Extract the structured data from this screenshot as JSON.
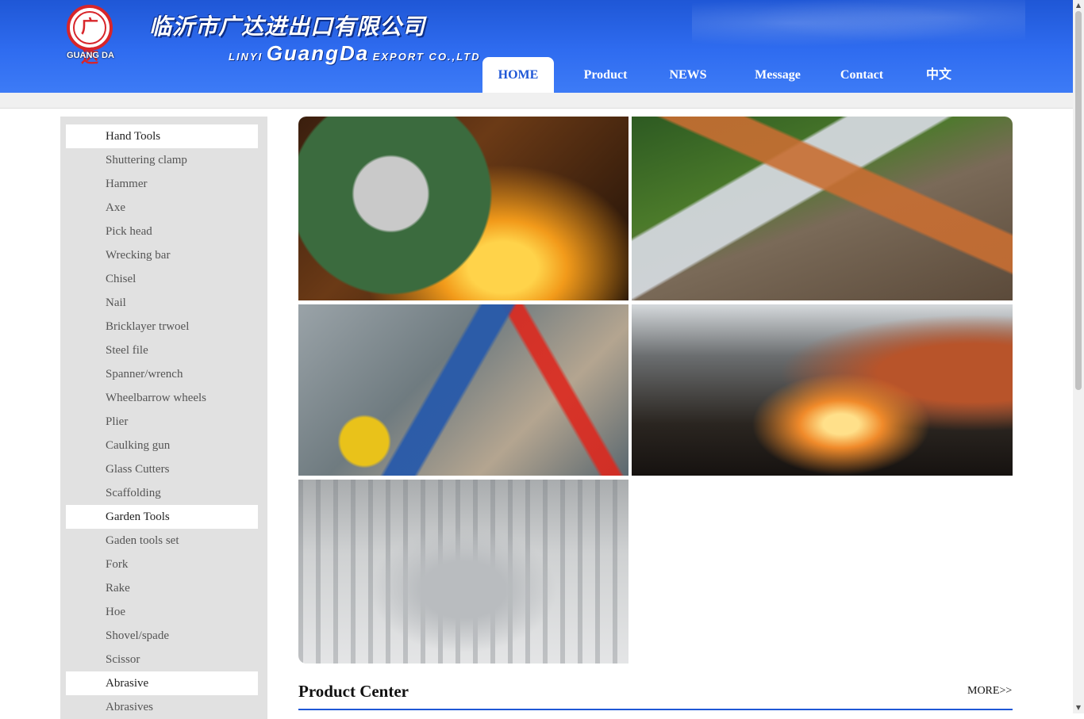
{
  "brand": {
    "logo_glyph": "广达",
    "logo_text": "GUANG DA",
    "name_cn": "临沂市广达进出口有限公司",
    "name_en_prefix": "LINYI",
    "name_en_main": "GuangDa",
    "name_en_suffix": "EXPORT CO.,LTD",
    "primary_color": "#1f57d6",
    "logo_color": "#d8252a"
  },
  "nav": {
    "items": [
      {
        "label": "HOME",
        "active": true
      },
      {
        "label": "Product",
        "active": false
      },
      {
        "label": "NEWS",
        "active": false
      },
      {
        "label": "Message",
        "active": false
      },
      {
        "label": "Contact",
        "active": false
      },
      {
        "label": "中文",
        "active": false
      }
    ]
  },
  "sidebar": {
    "items": [
      {
        "label": "Hand Tools",
        "type": "category"
      },
      {
        "label": "Shuttering clamp",
        "type": "item"
      },
      {
        "label": "Hammer",
        "type": "item"
      },
      {
        "label": "Axe",
        "type": "item"
      },
      {
        "label": "Pick head",
        "type": "item"
      },
      {
        "label": "Wrecking bar",
        "type": "item"
      },
      {
        "label": "Chisel",
        "type": "item"
      },
      {
        "label": "Nail",
        "type": "item"
      },
      {
        "label": "Bricklayer trwoel",
        "type": "item"
      },
      {
        "label": "Steel file",
        "type": "item"
      },
      {
        "label": "Spanner/wrench",
        "type": "item"
      },
      {
        "label": "Wheelbarrow wheels",
        "type": "item"
      },
      {
        "label": "Plier",
        "type": "item"
      },
      {
        "label": "Caulking gun",
        "type": "item"
      },
      {
        "label": "Glass Cutters",
        "type": "item"
      },
      {
        "label": "Scaffolding",
        "type": "item"
      },
      {
        "label": "Garden Tools",
        "type": "category"
      },
      {
        "label": "Gaden tools set",
        "type": "item"
      },
      {
        "label": "Fork",
        "type": "item"
      },
      {
        "label": "Rake",
        "type": "item"
      },
      {
        "label": "Hoe",
        "type": "item"
      },
      {
        "label": "Shovel/spade",
        "type": "item"
      },
      {
        "label": "Scissor",
        "type": "item"
      },
      {
        "label": "Abrasive",
        "type": "category"
      },
      {
        "label": "Abrasives",
        "type": "item"
      }
    ]
  },
  "gallery": {
    "images": [
      {
        "name": "angle-grinder-sparks-photo"
      },
      {
        "name": "garden-trowel-fork-photo"
      },
      {
        "name": "hand-tools-assortment-photo"
      },
      {
        "name": "welding-sparks-photo"
      },
      {
        "name": "aluminum-profiles-photo"
      }
    ]
  },
  "product_center": {
    "title": "Product Center",
    "more_label": "MORE>>"
  }
}
